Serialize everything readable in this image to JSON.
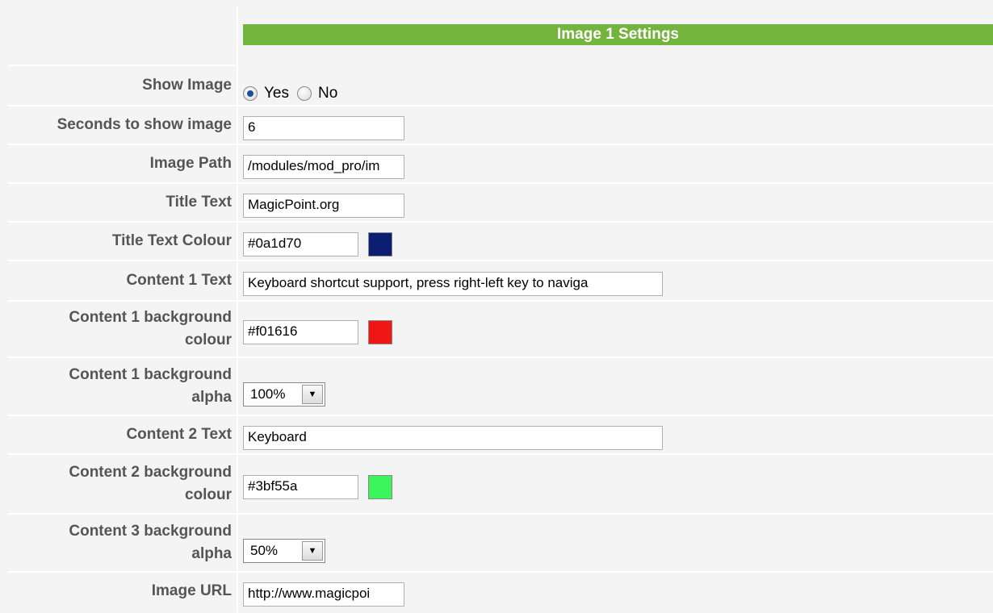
{
  "section": {
    "title": "Image 1 Settings"
  },
  "fields": {
    "show_image": {
      "label": "Show Image",
      "options": [
        "Yes",
        "No"
      ],
      "selected": "Yes"
    },
    "seconds": {
      "label": "Seconds to show image",
      "value": "6"
    },
    "image_path": {
      "label": "Image Path",
      "value": "/modules/mod_pro/im"
    },
    "title_text": {
      "label": "Title Text",
      "value": "MagicPoint.org"
    },
    "title_colour": {
      "label": "Title Text Colour",
      "value": "#0a1d70",
      "swatch": "#0a1d70"
    },
    "content1_text": {
      "label": "Content 1 Text",
      "value": "Keyboard shortcut support, press right-left key to naviga"
    },
    "content1_bg": {
      "label_line1": "Content 1 background",
      "label_line2": "colour",
      "value": "#f01616",
      "swatch": "#f01616"
    },
    "content1_alpha": {
      "label_line1": "Content 1 background",
      "label_line2": "alpha",
      "value": "100%"
    },
    "content2_text": {
      "label": "Content 2 Text",
      "value": "Keyboard"
    },
    "content2_bg": {
      "label_line1": "Content 2 background",
      "label_line2": "colour",
      "value": "#3bf55a",
      "swatch": "#3bf55a"
    },
    "content3_alpha": {
      "label_line1": "Content 3 background",
      "label_line2": "alpha",
      "value": "50%"
    },
    "image_url": {
      "label": "Image URL",
      "value": "http://www.magicpoi"
    }
  },
  "icons": {
    "dropdown": "dropdown-arrow-icon"
  },
  "colors": {
    "header_green": "#73b43d",
    "label_grey": "#555555"
  }
}
